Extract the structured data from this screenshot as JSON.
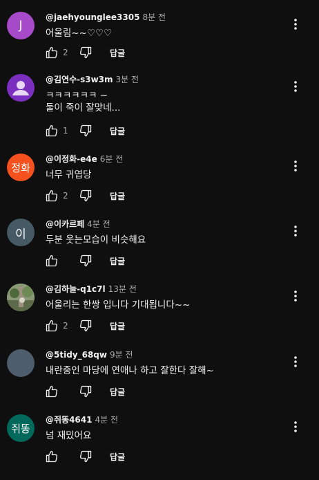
{
  "icons": {
    "like": "thumbs-up-icon",
    "dislike": "thumbs-down-icon",
    "more": "more-vert-icon"
  },
  "comments": [
    {
      "avatar": {
        "text": "J",
        "color": "#a64ac9"
      },
      "handle": "@jaehyounglee3305",
      "time": "8분 전",
      "text": "어울림~~♡♡♡",
      "likes": "2",
      "reply": "답글"
    },
    {
      "avatar": {
        "text": "",
        "color": "#7b2fbe",
        "icon": "person-icon"
      },
      "handle": "@김연수-s3w3m",
      "time": "3분 전",
      "text": "ㅋㅋㅋㅋㅋㅋ ~\n둘이 죽이 잘맞네...",
      "likes": "1",
      "reply": "답글"
    },
    {
      "avatar": {
        "text": "정화",
        "color": "#f4511e"
      },
      "handle": "@이정화-e4e",
      "time": "6분 전",
      "text": "너무 귀엽당",
      "likes": "2",
      "reply": "답글"
    },
    {
      "avatar": {
        "text": "이",
        "color": "#455a64"
      },
      "handle": "@이카르페",
      "time": "4분 전",
      "text": "두분 웃는모습이 비슷해요",
      "likes": "",
      "reply": "답글"
    },
    {
      "avatar": {
        "text": "",
        "color": "#6d7a5a",
        "icon": "photo-avatar"
      },
      "handle": "@김하늘-q1c7l",
      "time": "13분 전",
      "text": "어울리는 한쌍 입니다 기대됩니다~~",
      "likes": "2",
      "reply": "답글"
    },
    {
      "avatar": {
        "text": "",
        "color": "#4e5d6c"
      },
      "handle": "@5tidy_68qw",
      "time": "9분 전",
      "text": "내란중인 마당에 연애나 하고 잘한다 잘해~",
      "likes": "",
      "reply": "답글"
    },
    {
      "avatar": {
        "text": "쥐똥",
        "color": "#00695c"
      },
      "handle": "@쥐똥4641",
      "time": "4분 전",
      "text": "넘 재밌어요",
      "likes": "",
      "reply": "답글"
    }
  ]
}
